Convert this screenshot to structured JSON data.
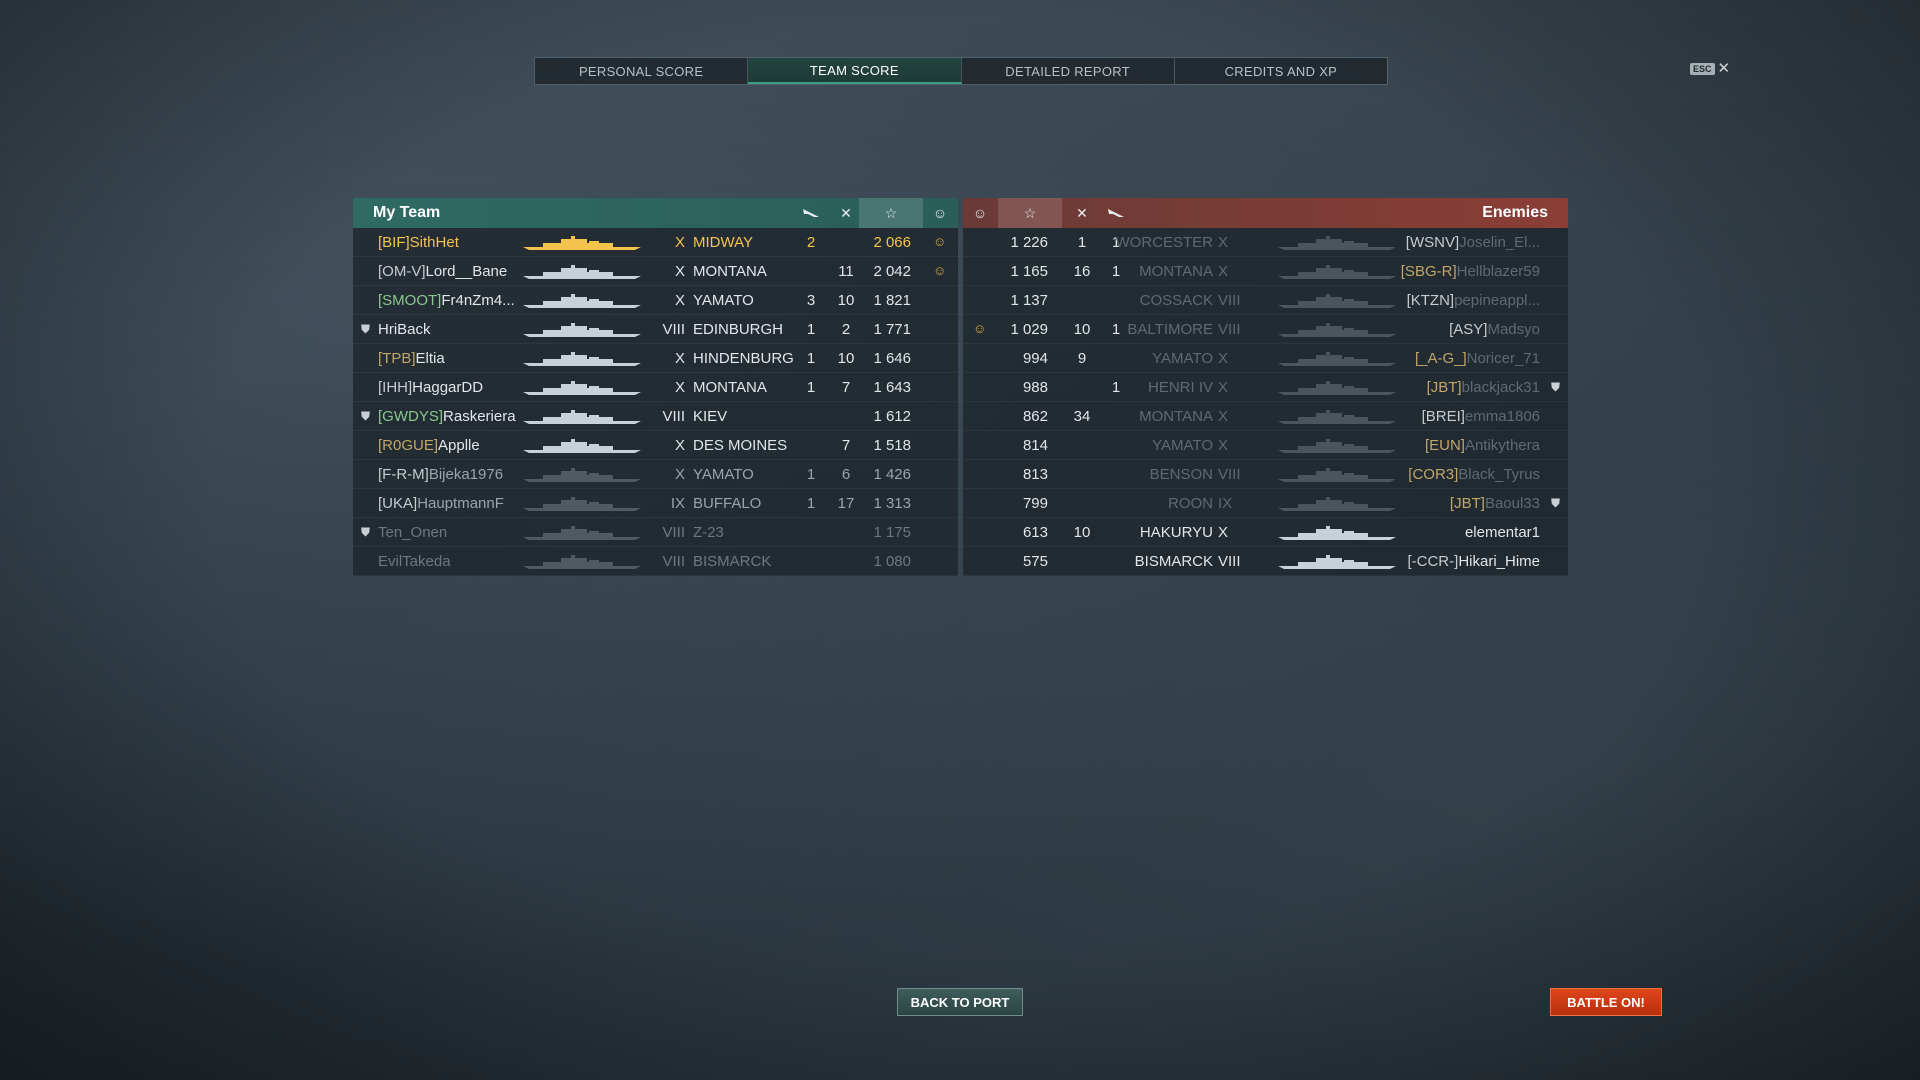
{
  "tabs": [
    "PERSONAL SCORE",
    "TEAM SCORE",
    "DETAILED REPORT",
    "CREDITS AND XP"
  ],
  "active_tab": "TEAM SCORE",
  "esc": {
    "key": "ESC",
    "close": "✕"
  },
  "my_team": {
    "title": "My Team",
    "rows": [
      {
        "clan": "[BIF]",
        "name": "SithHet",
        "tier": "X",
        "ship": "MIDWAY",
        "planes": "2",
        "kills": "",
        "score": "2 066",
        "res": true,
        "style": "hl",
        "clan_color": "gold"
      },
      {
        "clan": "[OM-V]",
        "name": "Lord__Bane",
        "tier": "X",
        "ship": "MONTANA",
        "planes": "",
        "kills": "11",
        "score": "2 042",
        "res": true,
        "style": "",
        "clan_color": "grey"
      },
      {
        "clan": "[SMOOT]",
        "name": "Fr4nZm4...",
        "tier": "X",
        "ship": "YAMATO",
        "planes": "3",
        "kills": "10",
        "score": "1 821",
        "res": false,
        "style": "",
        "clan_color": "green"
      },
      {
        "clan": "",
        "name": "HriBack",
        "tier": "VIII",
        "ship": "EDINBURGH",
        "planes": "1",
        "kills": "2",
        "score": "1 771",
        "res": false,
        "style": "",
        "clan_color": "grey",
        "badge": true
      },
      {
        "clan": "[TPB]",
        "name": "Eltia",
        "tier": "X",
        "ship": "HINDENBURG",
        "planes": "1",
        "kills": "10",
        "score": "1 646",
        "res": false,
        "style": "",
        "clan_color": "gold"
      },
      {
        "clan": "[IHH]",
        "name": "HaggarDD",
        "tier": "X",
        "ship": "MONTANA",
        "planes": "1",
        "kills": "7",
        "score": "1 643",
        "res": false,
        "style": "",
        "clan_color": "grey"
      },
      {
        "clan": "[GWDYS]",
        "name": "Raskeriera",
        "tier": "VIII",
        "ship": "KIEV",
        "planes": "",
        "kills": "",
        "score": "1 612",
        "res": false,
        "style": "",
        "clan_color": "green",
        "badge": true
      },
      {
        "clan": "[R0GUE]",
        "name": "Applle",
        "tier": "X",
        "ship": "DES MOINES",
        "planes": "",
        "kills": "7",
        "score": "1 518",
        "res": false,
        "style": "",
        "clan_color": "gold"
      },
      {
        "clan": "[F-R-M]",
        "name": "Bijeka1976",
        "tier": "X",
        "ship": "YAMATO",
        "planes": "1",
        "kills": "6",
        "score": "1 426",
        "res": false,
        "style": "half",
        "clan_color": "grey"
      },
      {
        "clan": "[UKA]",
        "name": "HauptmannF",
        "tier": "IX",
        "ship": "BUFFALO",
        "planes": "1",
        "kills": "17",
        "score": "1 313",
        "res": false,
        "style": "half",
        "clan_color": "grey"
      },
      {
        "clan": "",
        "name": "Ten_Onen",
        "tier": "VIII",
        "ship": "Z-23",
        "planes": "",
        "kills": "",
        "score": "1 175",
        "res": false,
        "style": "dim",
        "clan_color": "grey",
        "badge": true
      },
      {
        "clan": "",
        "name": "EvilTakeda",
        "tier": "VIII",
        "ship": "BISMARCK",
        "planes": "",
        "kills": "",
        "score": "1 080",
        "res": false,
        "style": "dim",
        "clan_color": "grey"
      }
    ]
  },
  "enemies": {
    "title": "Enemies",
    "rows": [
      {
        "score": "1 226",
        "kills": "1",
        "planes": "1",
        "ship": "WORCESTER",
        "tier": "X",
        "clan": "[WSNV]",
        "name": "Joselin_El...",
        "res": false,
        "dead": true,
        "clan_color": "grey"
      },
      {
        "score": "1 165",
        "kills": "16",
        "planes": "1",
        "ship": "MONTANA",
        "tier": "X",
        "clan": "[SBG-R]",
        "name": "Hellblazer59",
        "res": false,
        "dead": true,
        "clan_color": "gold"
      },
      {
        "score": "1 137",
        "kills": "",
        "planes": "",
        "ship": "COSSACK",
        "tier": "VIII",
        "clan": "[KTZN]",
        "name": "pepineappl...",
        "res": false,
        "dead": true,
        "clan_color": "grey"
      },
      {
        "score": "1 029",
        "kills": "10",
        "planes": "1",
        "ship": "BALTIMORE",
        "tier": "VIII",
        "clan": "[ASY]",
        "name": "Madsyo",
        "res": true,
        "dead": true,
        "clan_color": "grey"
      },
      {
        "score": "994",
        "kills": "9",
        "planes": "",
        "ship": "YAMATO",
        "tier": "X",
        "clan": "[_A-G_]",
        "name": "Noricer_71",
        "res": false,
        "dead": true,
        "clan_color": "gold"
      },
      {
        "score": "988",
        "kills": "",
        "planes": "1",
        "ship": "HENRI IV",
        "tier": "X",
        "clan": "[JBT]",
        "name": "blackjack31",
        "res": false,
        "dead": true,
        "clan_color": "gold",
        "badge": true
      },
      {
        "score": "862",
        "kills": "34",
        "planes": "",
        "ship": "MONTANA",
        "tier": "X",
        "clan": "[BREI]",
        "name": "emma1806",
        "res": false,
        "dead": true,
        "clan_color": "grey"
      },
      {
        "score": "814",
        "kills": "",
        "planes": "",
        "ship": "YAMATO",
        "tier": "X",
        "clan": "[EUN]",
        "name": "Antikythera",
        "res": false,
        "dead": true,
        "clan_color": "gold"
      },
      {
        "score": "813",
        "kills": "",
        "planes": "",
        "ship": "BENSON",
        "tier": "VIII",
        "clan": "[COR3]",
        "name": "Black_Tyrus",
        "res": false,
        "dead": true,
        "clan_color": "gold"
      },
      {
        "score": "799",
        "kills": "",
        "planes": "",
        "ship": "ROON",
        "tier": "IX",
        "clan": "[JBT]",
        "name": "Baoul33",
        "res": false,
        "dead": true,
        "clan_color": "gold",
        "badge": true
      },
      {
        "score": "613",
        "kills": "10",
        "planes": "",
        "ship": "HAKURYU",
        "tier": "X",
        "clan": "",
        "name": "elementar1",
        "res": false,
        "dead": false,
        "clan_color": "grey"
      },
      {
        "score": "575",
        "kills": "",
        "planes": "",
        "ship": "BISMARCK",
        "tier": "VIII",
        "clan": "[-CCR-]",
        "name": "Hikari_Hime",
        "res": false,
        "dead": false,
        "clan_color": "grey"
      }
    ]
  },
  "buttons": {
    "back": "BACK TO PORT",
    "battle": "BATTLE ON!"
  },
  "icons": {
    "planes": "plane-icon",
    "kills": "crossed-swords-icon",
    "score": "star-icon",
    "res": "laurel-icon",
    "badge": "division-badge-icon"
  },
  "colors": {
    "accent_team": "#2f6a63",
    "accent_enemy": "#8a3e36",
    "highlight": "#f4c34c",
    "battle": "#d83e16"
  }
}
